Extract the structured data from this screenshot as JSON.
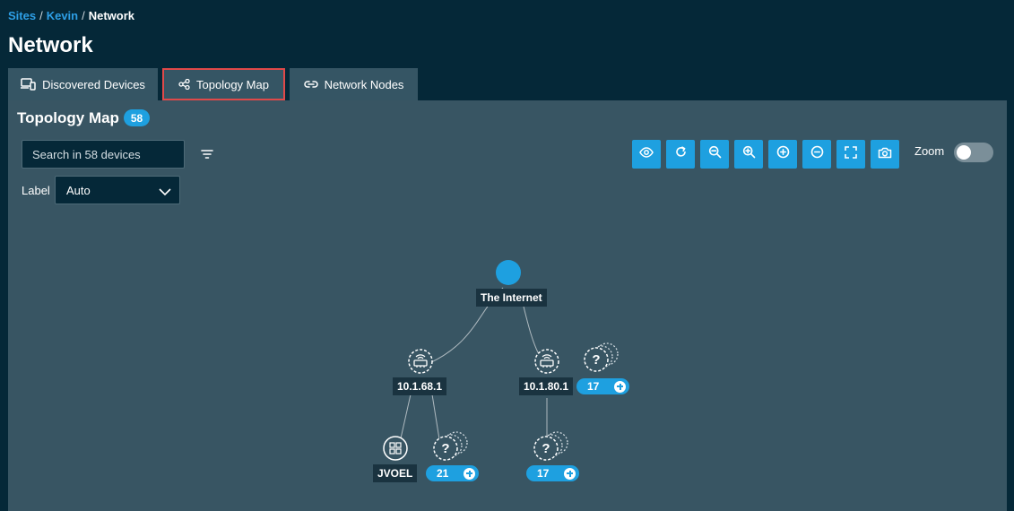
{
  "breadcrumb": {
    "sites": "Sites",
    "site": "Kevin",
    "current": "Network",
    "sep": "/"
  },
  "page_title": "Network",
  "tabs": [
    {
      "label": "Discovered Devices",
      "icon": "devices-icon"
    },
    {
      "label": "Topology Map",
      "icon": "share-nodes-icon",
      "active": true
    },
    {
      "label": "Network Nodes",
      "icon": "link-icon"
    }
  ],
  "panel": {
    "title": "Topology Map",
    "device_count": "58",
    "search_placeholder": "Search in 58 devices",
    "label_text": "Label",
    "label_value": "Auto",
    "zoom_label": "Zoom",
    "zoom_enabled": false
  },
  "toolbar": [
    {
      "name": "visibility-button",
      "icon": "eye-icon"
    },
    {
      "name": "refresh-button",
      "icon": "redo-icon"
    },
    {
      "name": "zoom-out-button",
      "icon": "magnifier-minus-icon"
    },
    {
      "name": "zoom-in-button",
      "icon": "magnifier-plus-icon"
    },
    {
      "name": "expand-all-button",
      "icon": "circle-plus-icon"
    },
    {
      "name": "collapse-all-button",
      "icon": "circle-minus-icon"
    },
    {
      "name": "fullscreen-button",
      "icon": "fullscreen-icon"
    },
    {
      "name": "screenshot-button",
      "icon": "camera-icon"
    }
  ],
  "topology": {
    "internet_label": "The Internet",
    "router_left_label": "10.1.68.1",
    "router_right_label": "10.1.80.1",
    "windows_host_label": "JVOEL",
    "unknown_group_right_count": "17",
    "unknown_group_left_count": "21",
    "unknown_group_bottom_count": "17"
  },
  "colors": {
    "accent": "#1ea0e0",
    "background": "#052838",
    "panel": "#385563",
    "active_tab_border": "#e04949"
  }
}
